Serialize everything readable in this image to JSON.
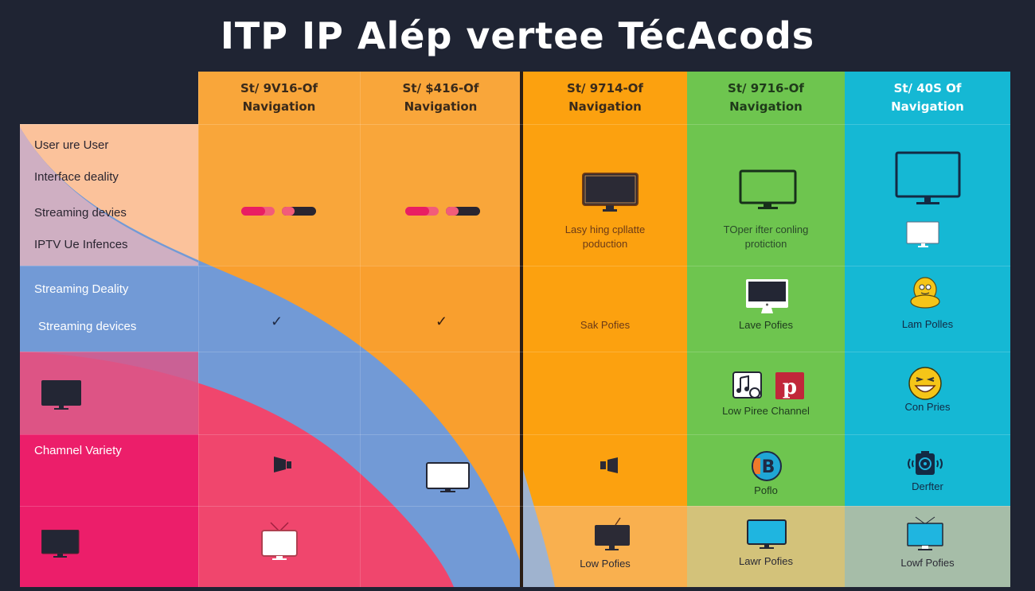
{
  "title": "ITP IP Alép vertee TécAcods",
  "colors": {
    "background": "#1f2433",
    "orange_light": "#f9a63a",
    "orange": "#fca10f",
    "peach": "#fbc29b",
    "blue": "#729ad6",
    "pink": "#f0466d",
    "magenta": "#ec1e6a",
    "green": "#6ec54f",
    "cyan": "#15b8d4",
    "sage": "#a6bda8",
    "divider": "#2a1d14"
  },
  "columns": [
    {
      "line1": "St/ 9V16-Of",
      "line2": "Navigation"
    },
    {
      "line1": "St/ $416-Of",
      "line2": "Navigation"
    },
    {
      "line1": "St/ 9714-Of",
      "line2": "Navigation"
    },
    {
      "line1": "St/ 9716-Of",
      "line2": "Navigation"
    },
    {
      "line1": "St/ 40S Of",
      "line2": "Navigation"
    }
  ],
  "row_labels": {
    "r1": [
      "User ure User",
      "Interface deality",
      "Streaming devies",
      "IPTV Ue Infences"
    ],
    "r2": [
      "Streaming Deality",
      "Streaming devices"
    ],
    "r4": "Chamnel Variety"
  },
  "cells": {
    "c3_r1": {
      "line1": "Lasy hing cpllatte",
      "line2": "poduction",
      "icon": "monitor-icon"
    },
    "c4_r1": {
      "line1": "TOper ifter conling",
      "line2": "protiction",
      "icon": "monitor-outline-icon"
    },
    "c5_r1": {
      "icon": "monitor-outline-icon"
    },
    "c3_r2": {
      "label": "Sak Pofies"
    },
    "c4_r2": {
      "label": "Lave Pofies",
      "icon": "desktop-computer-icon"
    },
    "c5_r2": {
      "label": "Lam Polles",
      "icon": "mascot-icon"
    },
    "c4_r3": {
      "label": "Low Piree Channel",
      "icons": [
        "music-app-icon",
        "pinterest-icon"
      ]
    },
    "c5_r3": {
      "label": "Con Pries",
      "icon": "laughing-emoji-icon"
    },
    "c4_r4": {
      "label": "Poflo",
      "icon": "b-logo-icon"
    },
    "c5_r4": {
      "label": "Derfter",
      "icon": "camera-icon"
    },
    "c3_r5": {
      "label": "Low Pofies",
      "icon": "tv-icon"
    },
    "c4_r5": {
      "label": "Lawr Pofies",
      "icon": "monitor-icon"
    },
    "c5_r5": {
      "label": "Lowf Pofies",
      "icon": "tv-icon"
    }
  },
  "progress_pills": [
    {
      "segments": [
        "#e91e63",
        "#f25c7a"
      ]
    },
    {
      "segments": [
        "#f25c7a",
        "#2a2530"
      ]
    }
  ],
  "checkmarks": [
    "✓",
    "✓"
  ]
}
